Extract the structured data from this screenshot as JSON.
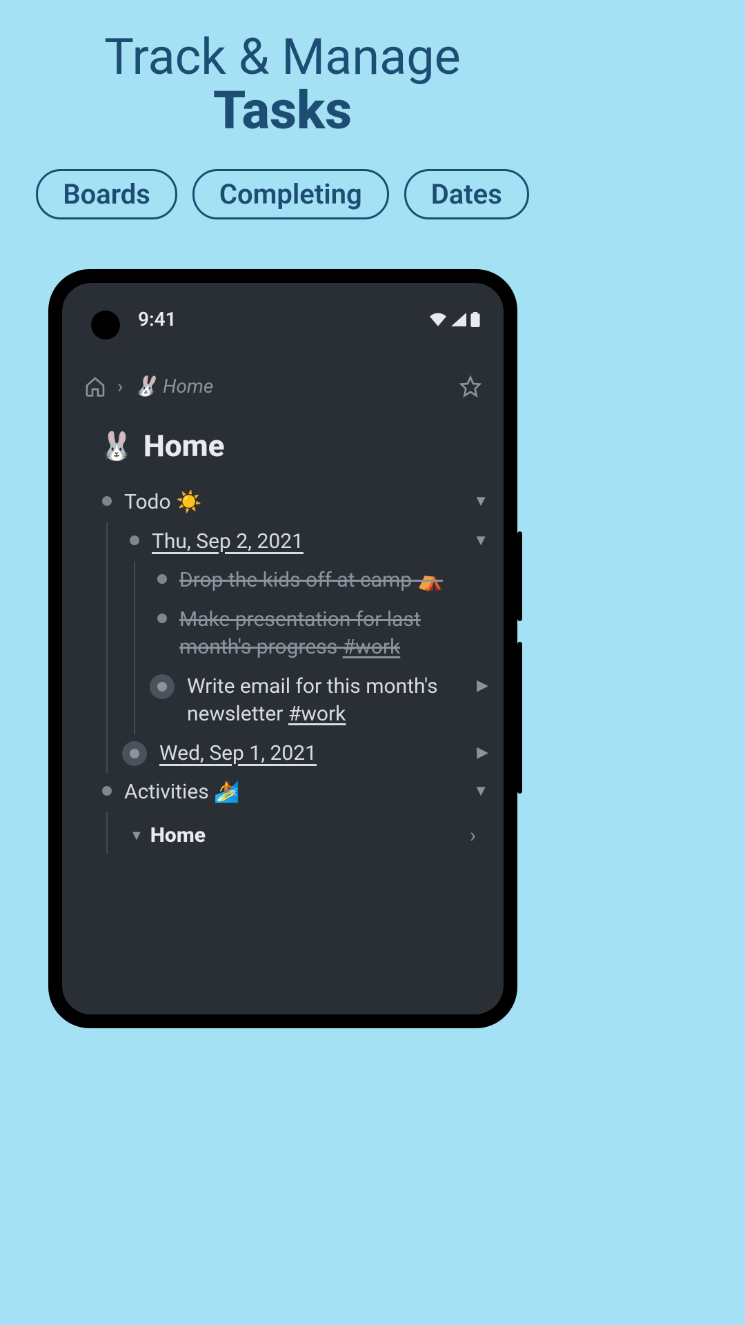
{
  "promo": {
    "line1": "Track & Manage",
    "line2": "Tasks",
    "pills": [
      "Boards",
      "Completing",
      "Dates"
    ]
  },
  "statusbar": {
    "time": "9:41"
  },
  "breadcrumb": {
    "label": "🐰 Home"
  },
  "page": {
    "emoji": "🐰",
    "title": "Home"
  },
  "outline": {
    "todo": {
      "label": "Todo ☀️",
      "date1": {
        "label": "Thu, Sep 2, 2021",
        "task1": "Drop the kids off at camp ⛺",
        "task2_text": "Make presentation for last month's progress ",
        "task2_tag": "#work",
        "task3_text": "Write email for this month's newsletter ",
        "task3_tag": "#work"
      },
      "date2": {
        "label": "Wed, Sep 1, 2021"
      }
    },
    "activities": {
      "label": "Activities 🏄"
    },
    "section": {
      "title": "Home"
    }
  }
}
